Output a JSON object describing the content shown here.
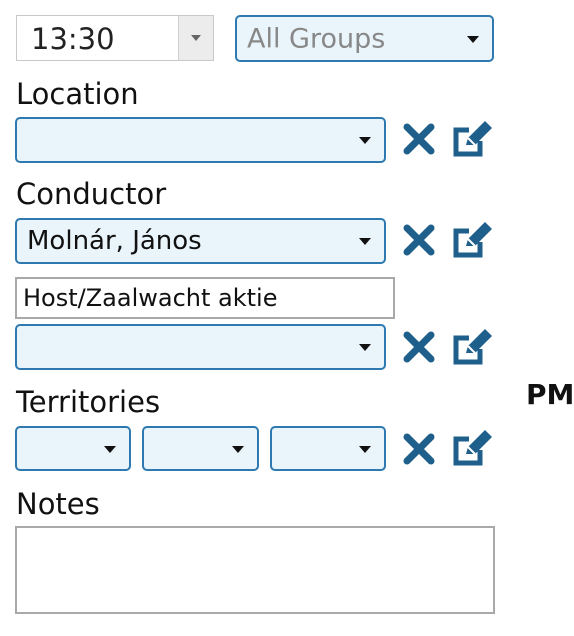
{
  "time": {
    "value": "13:30"
  },
  "group_select": {
    "value": "All Groups"
  },
  "location": {
    "label": "Location",
    "value": ""
  },
  "conductor": {
    "label": "Conductor",
    "value": "Molnár, János"
  },
  "host": {
    "label_value": "Host/Zaalwacht aktie",
    "value": ""
  },
  "territories": {
    "label": "Territories",
    "values": [
      "",
      "",
      ""
    ]
  },
  "notes": {
    "label": "Notes",
    "value": ""
  },
  "period": {
    "label": "PM"
  },
  "icons": {
    "clear": "close-x-icon",
    "edit": "edit-pencil-square-icon",
    "dropdown": "caret-down-icon"
  },
  "colors": {
    "accent": "#2e7ab0",
    "icon": "#1f5f8b",
    "select_bg": "#e9f4fb"
  }
}
